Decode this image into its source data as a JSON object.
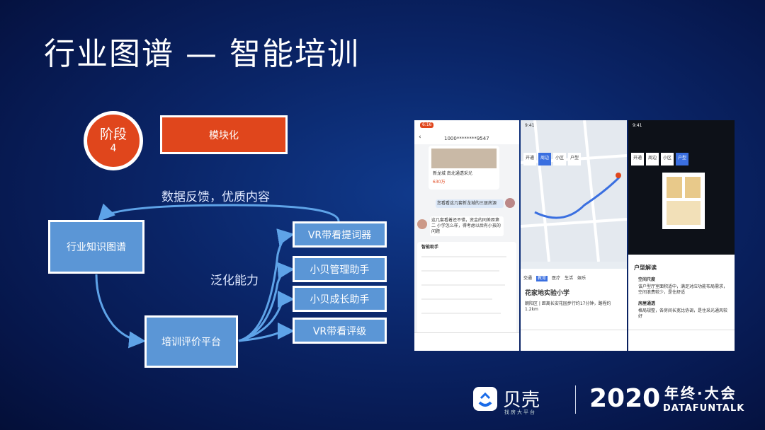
{
  "title": "行业图谱 — 智能培训",
  "stage": {
    "line1": "阶段",
    "line2": "4"
  },
  "module_label": "模块化",
  "feedback_label": "数据反馈，优质内容",
  "generalize_label": "泛化能力",
  "knowledge_graph_label": "行业知识图谱",
  "training_platform_label": "培训评价平台",
  "outputs": [
    "VR带看提词器",
    "小贝管理助手",
    "小贝成长助手",
    "VR带看评级"
  ],
  "colors": {
    "accent_red": "#e0461c",
    "box_blue": "#5b96d6",
    "background": "#0a2466"
  },
  "phone1": {
    "time": "6:16",
    "contact": "1000********9547",
    "listing": "新龙城 南北通透采光",
    "price": "630万",
    "question": "您看看这几套新龙城的三居房源",
    "reply": "这几套看着还不错，资金的同差距第二 小学怎么样，得考虑以后有小孩的问题",
    "assistant": "智能助手"
  },
  "phone2": {
    "time": "9:41",
    "tabs": [
      "开通",
      "周边",
      "小区",
      "户型"
    ],
    "school": "花家地实验小学",
    "address": "朝阳区 | 距离长安花园步行约17分钟，路程约1.2km",
    "categories": [
      "交通",
      "教育",
      "医疗",
      "生活",
      "娱乐"
    ]
  },
  "phone3": {
    "time": "9:41",
    "tabs": [
      "开通",
      "周边",
      "小区",
      "户型"
    ],
    "section_title": "户型解读",
    "item1_title": "空间尺度",
    "item1_text": "该户型厅室面积适中，满足对应功能布局需求，空间浪费较少，是住舒适",
    "item2_title": "房屋通透",
    "item2_text": "格局规整，各房间长宽比协调，是住采光通风较好"
  },
  "footer": {
    "brand": "贝壳",
    "brand_sub": "找房大平台",
    "year": "2020",
    "event": "年终·大会",
    "org": "DATAFUNTALK"
  }
}
